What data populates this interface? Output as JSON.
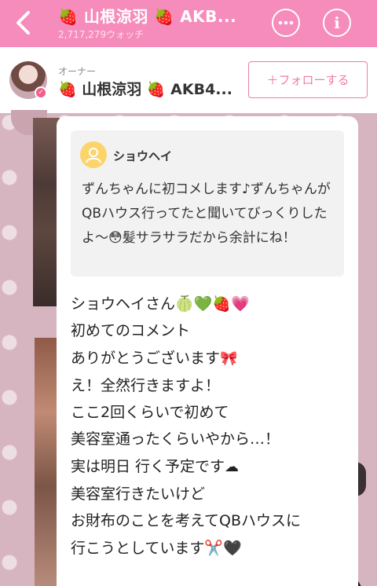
{
  "header": {
    "title": "🍓 山根涼羽 🍓 AKB...",
    "watch_count": "2,717,279ウォッチ",
    "back_icon": "chevron-left-icon",
    "comment_icon": "comment-bubble-icon",
    "info_icon": "info-icon"
  },
  "owner": {
    "label": "オーナー",
    "name": "🍓 山根涼羽 🍓 AKB4...",
    "follow_label": "＋フォローする"
  },
  "quote": {
    "author": "ショウヘイ",
    "text": "ずんちゃんに初コメします♪ずんちゃんがQBハウス行ってたと聞いてびっくりしたよ〜😳髪サラサラだから余計にね！"
  },
  "reply": {
    "lines": [
      "ショウヘイさん🍈💚🍓💗",
      "初めてのコメント",
      "ありがとうございます",
      "え！全然行きますよ！",
      "ここ2回くらいで初めて",
      "美容室通ったくらいやから…！",
      "実は明日 行く予定です",
      "美容室行きたいけど",
      "お財布のことを考えてQBハウスに",
      "行こうとしています✂️🖤"
    ]
  },
  "colors": {
    "header_bg": "#f58cbb",
    "accent": "#f07ca8",
    "background": "#d7b5c0"
  }
}
